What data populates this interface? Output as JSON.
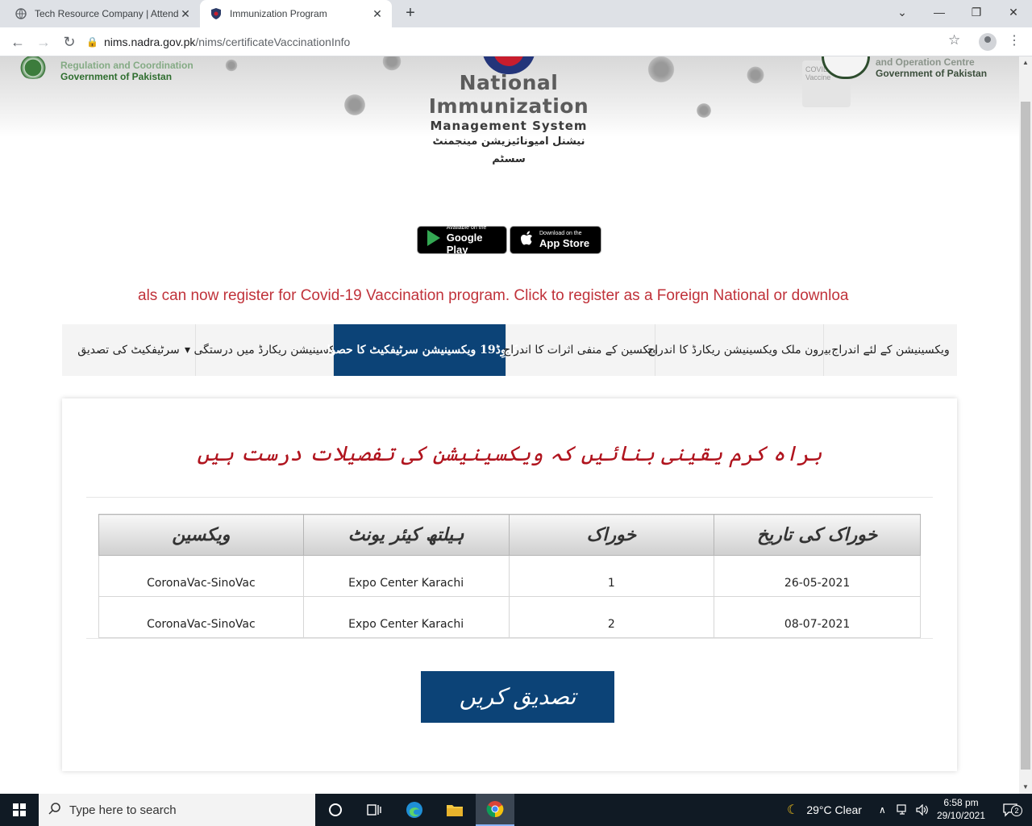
{
  "browser": {
    "tabs": [
      {
        "title": "Tech Resource Company | Attend",
        "icon": "globe-icon"
      },
      {
        "title": "Immunization Program",
        "icon": "shield-icon"
      }
    ],
    "url_domain": "nims.nadra.gov.pk",
    "url_path": "/nims/certificateVaccinationInfo"
  },
  "header": {
    "left_org_line1": "Regulation and Coordination",
    "left_org_line2": "Government of Pakistan",
    "right_org_line1": "and Operation Centre",
    "right_org_line2": "Government of Pakistan",
    "vial_text_1": "COVID",
    "vial_text_2": "Vaccine",
    "logo_line1": "National",
    "logo_line2": "Immunization",
    "logo_line3": "Management System",
    "logo_urdu": "نیشنل امیونائیزیشن مینجمنٹ سسٹم"
  },
  "stores": {
    "google_small": "Available on the",
    "google_big": "Google Play",
    "apple_small": "Download on the",
    "apple_big": "App Store"
  },
  "marquee": "als can now register for Covid-19 Vaccination program. Click to register as a Foreign National or downloa",
  "nav": {
    "items": [
      {
        "label": "ویکسینیشن کے لئے اندراج"
      },
      {
        "label": "بیرون ملک ویکسینیشن ریکارڈ کا اندراج"
      },
      {
        "label": "ویکسین کے منفی اثرات کا اندراج"
      },
      {
        "label": "کووِڈ19 ویکسینیشن سرٹیفکیٹ کا حصول"
      },
      {
        "label": "ویکسینیشن ریکارڈ میں درستگی ▾"
      },
      {
        "label": "سرٹیفکیٹ کی تصدیق"
      }
    ]
  },
  "card": {
    "heading": "براہ کرم یقینی بنائیں کہ ویکسینیشن کی تفصیلات درست ہیں",
    "table": {
      "headers": [
        "ویکسین",
        "ہیلتھ کیئر یونٹ",
        "خوراک",
        "خوراک کی تاریخ"
      ],
      "rows": [
        {
          "vaccine": "CoronaVac-SinoVac",
          "unit": "Expo Center Karachi",
          "dose": "1",
          "date": "26-05-2021"
        },
        {
          "vaccine": "CoronaVac-SinoVac",
          "unit": "Expo Center Karachi",
          "dose": "2",
          "date": "08-07-2021"
        }
      ]
    },
    "verify_label": "تصدیق کریں"
  },
  "taskbar": {
    "search_placeholder": "Type here to search",
    "weather": "29°C  Clear",
    "time": "6:58 pm",
    "date": "29/10/2021",
    "notifications": "2"
  }
}
